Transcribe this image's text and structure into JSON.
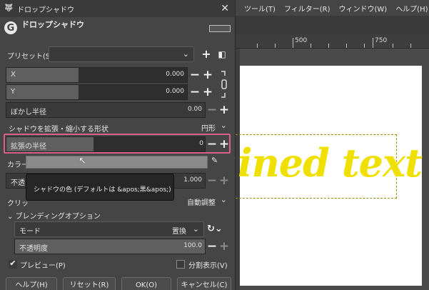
{
  "background": {
    "menus": [
      "ツール(T)",
      "フィルター(R)",
      "ウィンドウ(W)",
      "ヘルプ(H)"
    ],
    "ruler": [
      "500",
      "750"
    ],
    "canvas_text": "ined text",
    "canvas_text_color": "#f0e000"
  },
  "dialog": {
    "title": "ドロップシャドウ",
    "header_title": "ドロップシャドウ",
    "preset_label": "プリセット(S):",
    "preset_value": "",
    "x": {
      "label": "X",
      "value": "0.000",
      "fraction": 0.4
    },
    "y": {
      "label": "Y",
      "value": "0.000",
      "fraction": 0.4
    },
    "blur": {
      "label": "ぼかし半径",
      "value": "0.00"
    },
    "shape": {
      "label": "シャドウを拡張・縮小する形状",
      "value": "円形"
    },
    "grow_radius": {
      "label": "拡張の半径",
      "value": "0",
      "fraction": 0.44
    },
    "color_label": "カラー",
    "tooltip": "シャドウの色 (デフォルトは &apos;黒&apos;)",
    "opacity": {
      "label": "不透",
      "value": "1.000"
    },
    "clipping": {
      "label": "クリッ",
      "value": "自動調整"
    },
    "blending_label": "ブレンディングオプション",
    "mode": {
      "label": "モード",
      "value": "置換"
    },
    "blend_opacity": {
      "label": "不透明度",
      "value": "100.0"
    },
    "preview": {
      "label": "プレビュー(P)",
      "checked": true
    },
    "split": {
      "label": "分割表示(V)",
      "checked": false
    },
    "buttons": {
      "help": "ヘルプ(H)",
      "reset": "リセット(R)",
      "ok": "OK(O)",
      "cancel": "キャンセル(C)"
    }
  }
}
